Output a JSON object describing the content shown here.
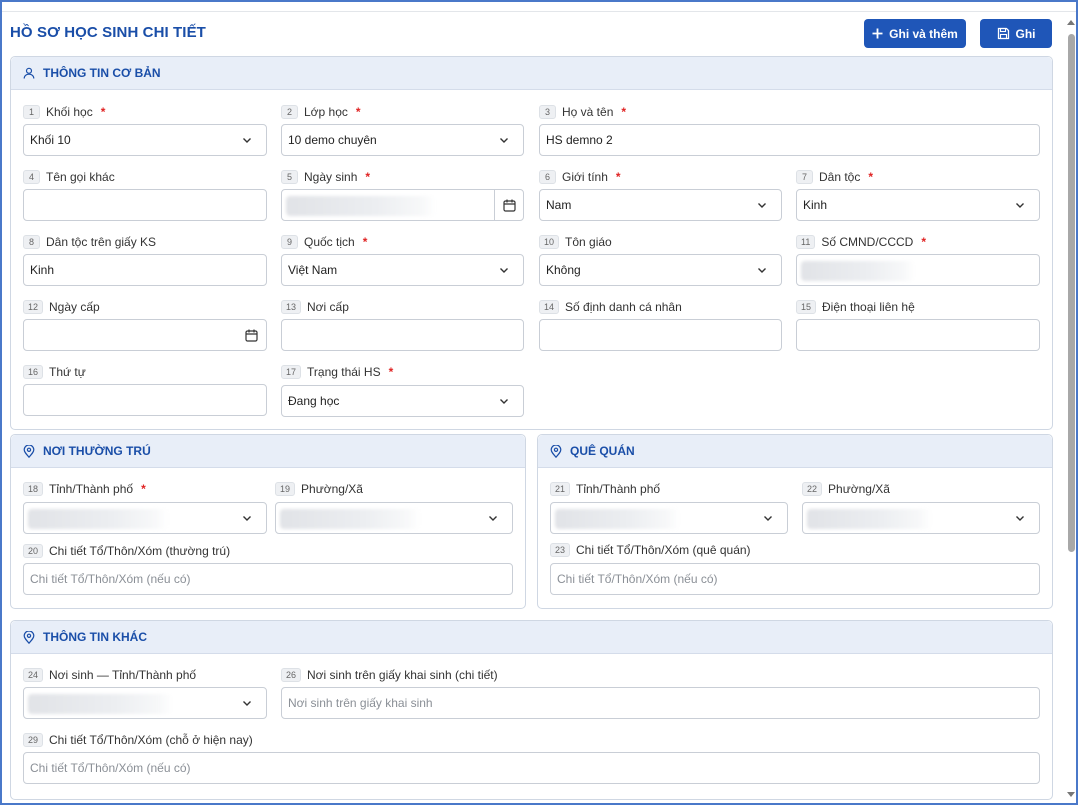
{
  "page": {
    "title": "HỒ SƠ HỌC SINH CHI TIẾT",
    "btn_add_label": "Ghi và thêm",
    "btn_save_label": "Ghi",
    "accent": "#1f56b8",
    "annotation_arrow_color": "#e3343a"
  },
  "sections": {
    "basic": "THÔNG TIN CƠ BẢN",
    "residence": "NƠI THƯỜNG TRÚ",
    "hometown": "QUÊ QUÁN",
    "other": "THÔNG TIN KHÁC"
  },
  "fields": {
    "f1": {
      "num": "1",
      "label": "Khối học",
      "value": "Khối 10"
    },
    "f2": {
      "num": "2",
      "label": "Lớp học",
      "value": "10 demo chuyên"
    },
    "f3": {
      "num": "3",
      "label": "Họ và tên",
      "value": "HS demno 2"
    },
    "f4": {
      "num": "4",
      "label": "Tên gọi khác",
      "value": ""
    },
    "f5": {
      "num": "5",
      "label": "Ngày sinh",
      "value": ""
    },
    "f6": {
      "num": "6",
      "label": "Giới tính",
      "value": "Nam"
    },
    "f7": {
      "num": "7",
      "label": "Dân tộc",
      "value": "Kinh"
    },
    "f8": {
      "num": "8",
      "label": "Dân tộc trên giấy KS",
      "value": "Kinh"
    },
    "f9": {
      "num": "9",
      "label": "Quốc tịch",
      "value": "Việt Nam"
    },
    "f10": {
      "num": "10",
      "label": "Tôn giáo",
      "value": "Không"
    },
    "f11": {
      "num": "11",
      "label": "Số CMND/CCCD",
      "value": ""
    },
    "f12": {
      "num": "12",
      "label": "Ngày cấp",
      "value": ""
    },
    "f13": {
      "num": "13",
      "label": "Nơi cấp",
      "value": ""
    },
    "f14": {
      "num": "14",
      "label": "Số định danh cá nhân",
      "value": ""
    },
    "f15": {
      "num": "15",
      "label": "Điện thoại liên hệ",
      "value": ""
    },
    "f16": {
      "num": "16",
      "label": "Thứ tự",
      "value": ""
    },
    "f17": {
      "num": "17",
      "label": "Trạng thái HS",
      "value": "Đang học"
    },
    "f18": {
      "num": "18",
      "label": "Tỉnh/Thành phố",
      "value": ""
    },
    "f19": {
      "num": "19",
      "label": "Phường/Xã",
      "value": ""
    },
    "f20": {
      "num": "20",
      "label": "Chi tiết Tổ/Thôn/Xóm (thường trú)",
      "placeholder": "Chi tiết Tổ/Thôn/Xóm (nếu có)"
    },
    "f21": {
      "num": "21",
      "label": "Tỉnh/Thành phố",
      "value": ""
    },
    "f22": {
      "num": "22",
      "label": "Phường/Xã",
      "value": ""
    },
    "f23": {
      "num": "23",
      "label": "Chi tiết Tổ/Thôn/Xóm (quê quán)",
      "placeholder": "Chi tiết Tổ/Thôn/Xóm (nếu có)"
    },
    "f24": {
      "num": "24",
      "label": "Nơi sinh — Tỉnh/Thành phố",
      "value": ""
    },
    "f26": {
      "num": "26",
      "label": "Nơi sinh trên giấy khai sinh (chi tiết)",
      "placeholder": "Nơi sinh trên giấy khai sinh"
    },
    "f29": {
      "num": "29",
      "label": "Chi tiết Tổ/Thôn/Xóm (chỗ ở hiện nay)",
      "placeholder": "Chi tiết Tổ/Thôn/Xóm (nếu có)"
    }
  }
}
